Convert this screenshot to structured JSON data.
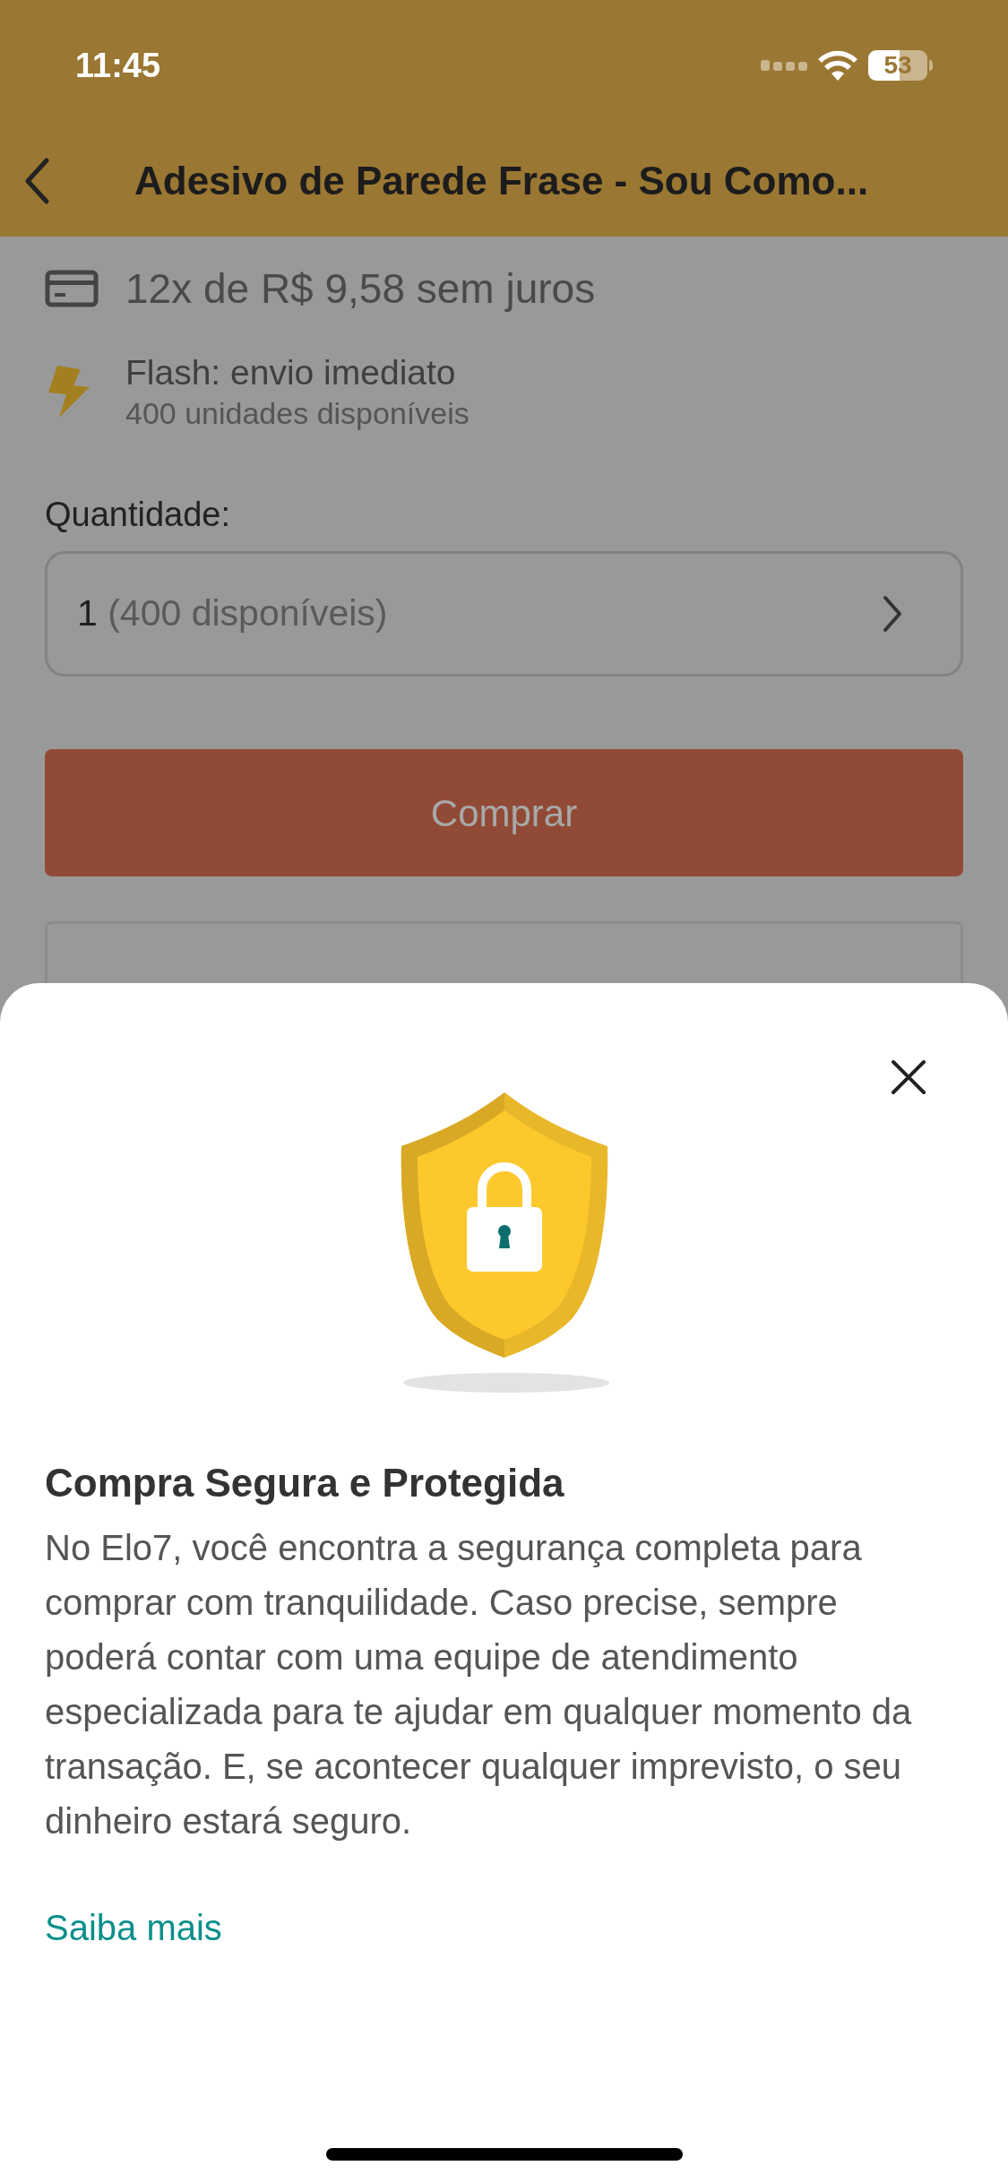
{
  "status_bar": {
    "time": "11:45",
    "battery": "53"
  },
  "header": {
    "title": "Adesivo de Parede Frase - Sou Como..."
  },
  "installments": {
    "text": "12x de R$ 9,58 sem juros"
  },
  "shipping": {
    "title": "Flash: envio imediato",
    "subtitle": "400 unidades disponíveis"
  },
  "quantity": {
    "label": "Quantidade:",
    "value": "1",
    "hint": "(400 disponíveis)"
  },
  "buy_button": {
    "label": "Comprar"
  },
  "sheet": {
    "title": "Compra Segura e Protegida",
    "body": "No Elo7, você encontra a segurança completa para comprar com tranquilidade. Caso precise, sempre poderá contar com uma equipe de atendimento especializada para te ajudar em qualquer momento da transação. E, se acontecer qualquer imprevisto, o seu dinheiro estará seguro.",
    "link": "Saiba mais"
  }
}
